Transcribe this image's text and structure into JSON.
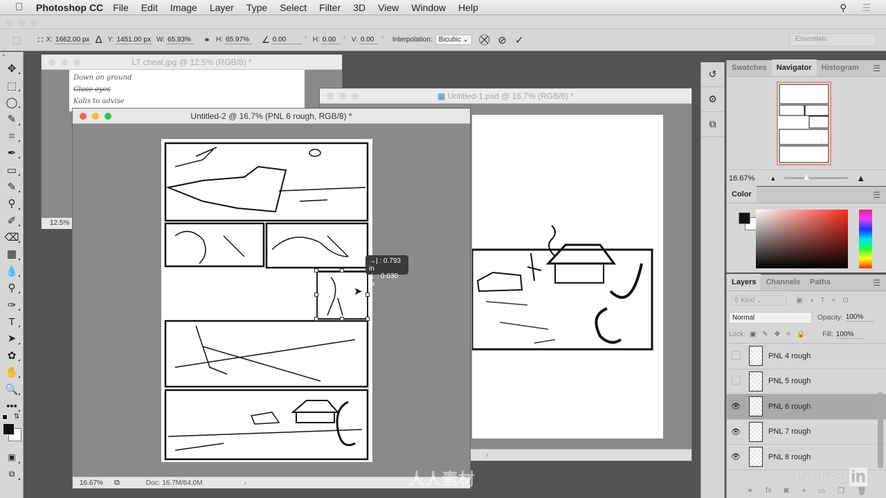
{
  "menubar": {
    "apple": "",
    "app": "Photoshop CC",
    "items": [
      "File",
      "Edit",
      "Image",
      "Layer",
      "Type",
      "Select",
      "Filter",
      "3D",
      "View",
      "Window",
      "Help"
    ],
    "search_icon": "search-icon",
    "list_icon": "list-icon"
  },
  "options": {
    "x_label": "X:",
    "x_value": "1662.00 px",
    "y_label": "Y:",
    "y_value": "1451.00 px",
    "w_label": "W:",
    "w_value": "65.93%",
    "h_label": "H:",
    "h_value": "65.97%",
    "angle_value": "0.00",
    "hskew_label": "H:",
    "hskew_value": "0.00",
    "vskew_label": "V:",
    "vskew_value": "0.00",
    "degree": "°",
    "interp_label": "Interpolation:",
    "interp_value": "Bicubic",
    "workspace": "Essentials",
    "warp_icon": "⛒",
    "cancel_icon": "⊘",
    "commit_icon": "✓"
  },
  "tools": [
    "✥",
    "⬚",
    "◯",
    "✎",
    "⌗",
    "✒",
    "▭",
    "✎",
    "⚲",
    "✐",
    "⌫",
    "▦",
    "💧",
    "⚲",
    "✑",
    "T",
    "➤",
    "✿",
    "✋",
    "🔍",
    "•••"
  ],
  "docs": {
    "lt": {
      "title": "LT cheat.jpg @ 12.5% (RGB/8) *",
      "zoom": "12.5%",
      "notes": [
        "Down on ground",
        "Close eyes",
        "Kalis to advise"
      ]
    },
    "u1": {
      "title": "Untitled-1.psd @ 16.7% (RGB/8) *",
      "status_arrow": "›"
    },
    "u2": {
      "title": "Untitled-2 @ 16.7% (PNL 6 rough, RGB/8) *",
      "zoom": "16.67%",
      "doc": "Doc: 16.7M/64.0M",
      "status_arrow": "›"
    }
  },
  "hint": {
    "dx": "→| : 0.793 in",
    "dy": "⊥ : 0.030 in"
  },
  "navigator": {
    "tabs": [
      "Swatches",
      "Navigator",
      "Histogram"
    ],
    "active": 1,
    "zoom": "16.67%"
  },
  "color": {
    "tab": "Color",
    "fg": "#111111",
    "bg": "#ffffff",
    "hue": "#ff2a1a"
  },
  "layers": {
    "tabs": [
      "Layers",
      "Channels",
      "Paths"
    ],
    "active": 0,
    "kind": "Kind",
    "blend": "Normal",
    "opacity_label": "Opacity:",
    "opacity": "100%",
    "lock_label": "Lock:",
    "fill_label": "Fill:",
    "fill": "100%",
    "items": [
      {
        "name": "PNL 4 rough",
        "visible": false,
        "selected": false
      },
      {
        "name": "PNL 5 rough",
        "visible": false,
        "selected": false
      },
      {
        "name": "PNL 6 rough",
        "visible": true,
        "selected": true
      },
      {
        "name": "PNL 7 rough",
        "visible": true,
        "selected": false
      },
      {
        "name": "PNL 8 rough",
        "visible": true,
        "selected": false
      }
    ],
    "footer": [
      "⚭",
      "fx",
      "◙",
      "◑",
      "▭",
      "❐",
      "🗑"
    ]
  },
  "watermark": {
    "linkedin": "Linked",
    "in": "in",
    "site": "人人素材"
  }
}
